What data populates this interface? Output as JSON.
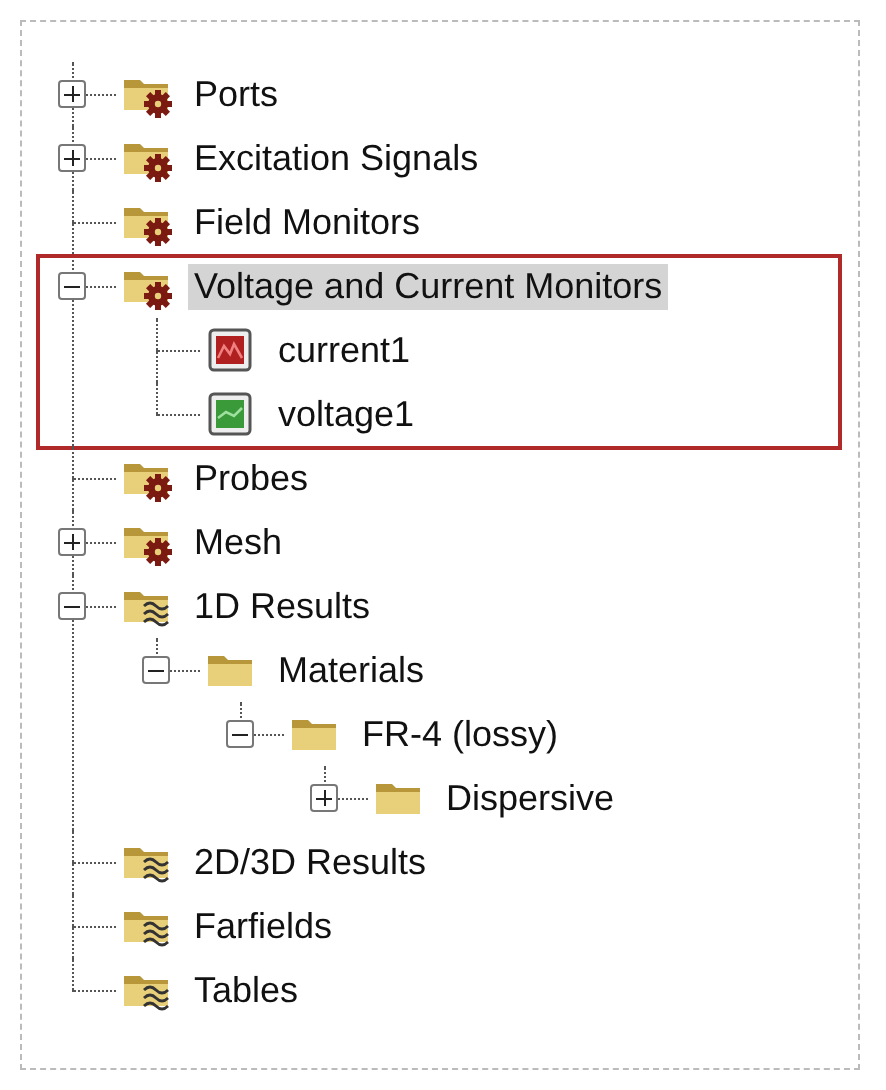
{
  "tree": [
    {
      "label": "Ports",
      "kind": "gear-folder",
      "expanded": false,
      "selected": false
    },
    {
      "label": "Excitation Signals",
      "kind": "gear-folder",
      "expanded": false,
      "selected": false
    },
    {
      "label": "Field Monitors",
      "kind": "gear-folder",
      "selected": false
    },
    {
      "label": "Voltage and Current Monitors",
      "kind": "gear-folder",
      "expanded": true,
      "selected": true,
      "outlined": true,
      "children": [
        {
          "label": "current1",
          "kind": "current-monitor",
          "selected": false
        },
        {
          "label": "voltage1",
          "kind": "voltage-monitor",
          "selected": false
        }
      ]
    },
    {
      "label": "Probes",
      "kind": "gear-folder",
      "selected": false
    },
    {
      "label": "Mesh",
      "kind": "gear-folder",
      "expanded": false,
      "selected": false
    },
    {
      "label": "1D Results",
      "kind": "wave-folder",
      "expanded": true,
      "selected": false,
      "children": [
        {
          "label": "Materials",
          "kind": "folder",
          "expanded": true,
          "selected": false,
          "children": [
            {
              "label": "FR-4 (lossy)",
              "kind": "folder",
              "expanded": true,
              "selected": false,
              "children": [
                {
                  "label": "Dispersive",
                  "kind": "folder",
                  "expanded": false,
                  "selected": false
                }
              ]
            }
          ]
        }
      ]
    },
    {
      "label": "2D/3D Results",
      "kind": "wave-folder",
      "selected": false
    },
    {
      "label": "Farfields",
      "kind": "wave-folder",
      "selected": false
    },
    {
      "label": "Tables",
      "kind": "wave-folder",
      "selected": false
    }
  ]
}
